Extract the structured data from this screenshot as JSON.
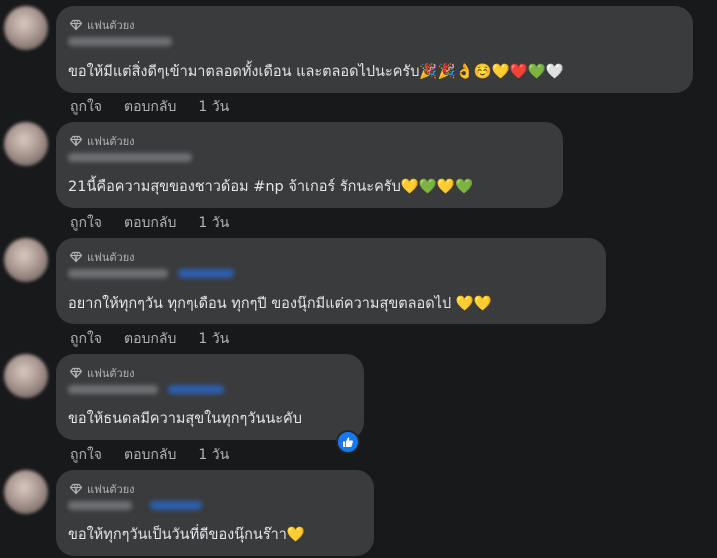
{
  "badge_label": "แฟนตัวยง",
  "actions": {
    "like": "ถูกใจ",
    "reply": "ตอบกลับ"
  },
  "comments": [
    {
      "text": "ขอให้มีแต่สิ่งดีๆเข้ามาตลอดทั้งเดือน และตลอดไปนะครับ🎉🎉👌☺️💛❤️💚🤍",
      "time": "1 วัน"
    },
    {
      "text": "21นี้คือความสุขของชาวด้อม #np จ้าเกอร์ รักนะครับ💛💚💛💚",
      "time": "1 วัน"
    },
    {
      "text": "อยากให้ทุกๆวัน ทุกๆเดือน ทุกๆปี ของนุ๊กมีแต่ความสุขตลอดไป 💛💛",
      "time": "1 วัน"
    },
    {
      "text": "ขอให้ธนดลมีความสุขในทุกๆวันนะคับ",
      "time": "1 วัน",
      "reaction": "like"
    },
    {
      "text": "ขอให้ทุกๆวันเป็นวันที่ดีของนุ๊กนร๊าา💛"
    }
  ],
  "colors": {
    "background": "#18191a",
    "bubble": "#3a3b3c",
    "secondary_text": "#b0b3b8",
    "like_blue": "#1877f2"
  }
}
